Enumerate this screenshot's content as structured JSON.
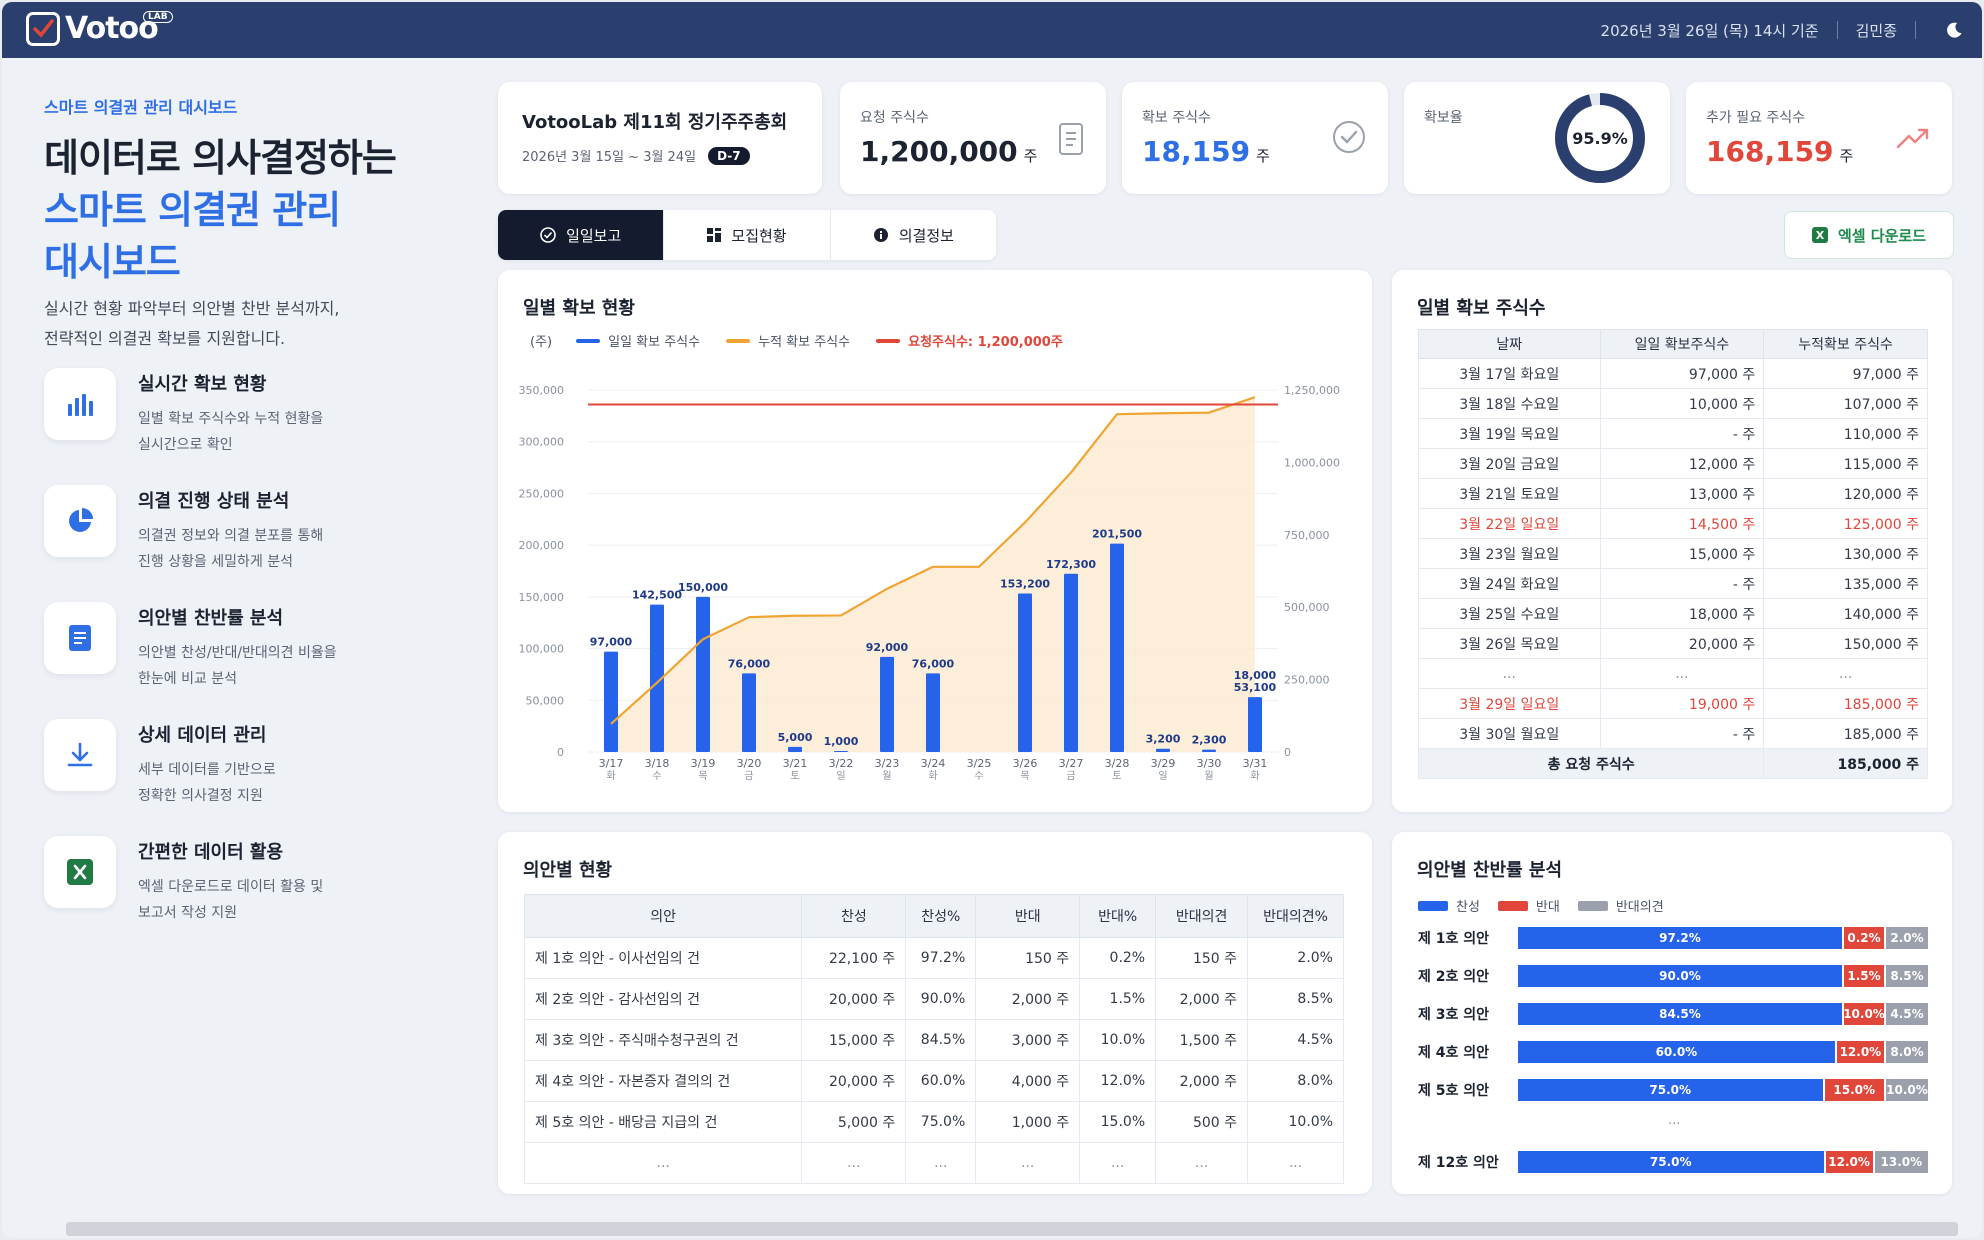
{
  "header": {
    "logo": "Votoo",
    "logo_badge": "LAB",
    "date_text": "2026년 3월 26일 (목) 14시 기준",
    "user": "김민종"
  },
  "hero": {
    "kicker": "스마트 의결권 관리 대시보드",
    "title_line1": "데이터로 의사결정하는",
    "title_line2": "스마트 의결권 관리",
    "title_line3": "대시보드",
    "desc_line1": "실시간 현황 파악부터 의안별 찬반 분석까지,",
    "desc_line2": "전략적인 의결권 확보를 지원합니다."
  },
  "features": [
    {
      "title": "실시간 확보 현황",
      "desc1": "일별 확보 주식수와 누적 현황을",
      "desc2": "실시간으로 확인",
      "icon": "bar-chart-icon"
    },
    {
      "title": "의결 진행 상태 분석",
      "desc1": "의결권 정보와 의결 분포를 통해",
      "desc2": "진행 상황을 세밀하게 분석",
      "icon": "pie-chart-icon"
    },
    {
      "title": "의안별 찬반률 분석",
      "desc1": "의안별 찬성/반대/반대의견 비율을",
      "desc2": "한눈에 비교 분석",
      "icon": "document-icon"
    },
    {
      "title": "상세 데이터 관리",
      "desc1": "세부 데이터를 기반으로",
      "desc2": "정확한 의사결정 지원",
      "icon": "download-icon"
    },
    {
      "title": "간편한 데이터 활용",
      "desc1": "엑셀 다운로드로 데이터 활용 및",
      "desc2": "보고서 작성 지원",
      "icon": "excel-icon"
    }
  ],
  "meeting": {
    "name": "VotooLab 제11회 정기주주총회",
    "period": "2026년 3월 15일 ~ 3월 24일",
    "dday": "D-7"
  },
  "stats": {
    "requested": {
      "label": "요청 주식수",
      "value": "1,200,000",
      "unit": "주"
    },
    "secured": {
      "label": "확보 주식수",
      "value": "18,159",
      "unit": "주"
    },
    "rate": {
      "label": "확보율",
      "value": "95.9%",
      "fraction": 0.959
    },
    "needed": {
      "label": "추가 필요 주식수",
      "value": "168,159",
      "unit": "주"
    }
  },
  "tabs": [
    {
      "label": "일일보고"
    },
    {
      "label": "모집현황"
    },
    {
      "label": "의결정보"
    }
  ],
  "excel_button": "엑셀 다운로드",
  "colors": {
    "bar": "#2563eb",
    "cumulative": "#f0a532",
    "target": "#e0463a",
    "area": "#fdebd3",
    "accent": "#2f6fe6",
    "red": "#e0463a",
    "gray": "#9aa1ac",
    "navy": "#2a3f6d"
  },
  "chart_data": {
    "type": "bar",
    "title": "일별 확보 현황",
    "unit_label": "(주)",
    "legend": [
      "일일 확보 주식수",
      "누적 확보 주식수",
      "요청주식수: 1,200,000주"
    ],
    "categories": [
      "3/17",
      "3/18",
      "3/19",
      "3/20",
      "3/21",
      "3/22",
      "3/23",
      "3/24",
      "3/25",
      "3/26",
      "3/27",
      "3/28",
      "3/29",
      "3/30",
      "3/31"
    ],
    "weekdays": [
      "화",
      "수",
      "목",
      "금",
      "토",
      "일",
      "월",
      "화",
      "수",
      "목",
      "금",
      "토",
      "일",
      "월",
      "화"
    ],
    "series": [
      {
        "name": "일일 확보 주식수",
        "axis": "left",
        "values": [
          97000,
          142500,
          150000,
          76000,
          5000,
          1000,
          92000,
          76000,
          0,
          153200,
          172300,
          201500,
          3200,
          2300,
          53100
        ],
        "labels": [
          "97,000",
          "142,500",
          "150,000",
          "76,000",
          "5,000",
          "1,000",
          "92,000",
          "76,000",
          "",
          "153,200",
          "172,300",
          "201,500",
          "3,200",
          "2,300",
          "18,000\n53,100"
        ]
      },
      {
        "name": "누적 확보 주식수",
        "axis": "right",
        "values": [
          97000,
          239500,
          389500,
          465500,
          470500,
          471500,
          563500,
          639500,
          639500,
          792700,
          965000,
          1166500,
          1169700,
          1172000,
          1225100
        ]
      },
      {
        "name": "요청주식수: 1,200,000주",
        "axis": "right",
        "values": [
          1200000,
          1200000,
          1200000,
          1200000,
          1200000,
          1200000,
          1200000,
          1200000,
          1200000,
          1200000,
          1200000,
          1200000,
          1200000,
          1200000,
          1200000
        ]
      }
    ],
    "ylim_left": [
      0,
      350000
    ],
    "ylim_right": [
      0,
      1250000
    ],
    "yticks_left": [
      "0",
      "50,000",
      "100,000",
      "150,000",
      "200,000",
      "250,000",
      "300,000",
      "350,000"
    ],
    "yticks_right": [
      "0",
      "250,000",
      "500,000",
      "750,000",
      "1,000,000",
      "1,250,000"
    ],
    "grid": true
  },
  "daily_table": {
    "title": "일별 확보 주식수",
    "headers": [
      "날짜",
      "일일 확보주식수",
      "누적확보 주식수"
    ],
    "rows": [
      {
        "date": "3월 17일 화요일",
        "daily": "97,000 주",
        "cum": "97,000 주",
        "red": false
      },
      {
        "date": "3월 18일 수요일",
        "daily": "10,000 주",
        "cum": "107,000 주",
        "red": false
      },
      {
        "date": "3월 19일 목요일",
        "daily": "- 주",
        "cum": "110,000 주",
        "red": false
      },
      {
        "date": "3월 20일 금요일",
        "daily": "12,000 주",
        "cum": "115,000 주",
        "red": false
      },
      {
        "date": "3월 21일 토요일",
        "daily": "13,000 주",
        "cum": "120,000 주",
        "red": false
      },
      {
        "date": "3월 22일 일요일",
        "daily": "14,500 주",
        "cum": "125,000 주",
        "red": true
      },
      {
        "date": "3월 23일 월요일",
        "daily": "15,000 주",
        "cum": "130,000 주",
        "red": false
      },
      {
        "date": "3월 24일 화요일",
        "daily": "- 주",
        "cum": "135,000 주",
        "red": false
      },
      {
        "date": "3월 25일 수요일",
        "daily": "18,000 주",
        "cum": "140,000 주",
        "red": false
      },
      {
        "date": "3월 26일 목요일",
        "daily": "20,000 주",
        "cum": "150,000 주",
        "red": false
      },
      {
        "date": "...",
        "daily": "...",
        "cum": "...",
        "red": false
      },
      {
        "date": "3월 29일 일요일",
        "daily": "19,000 주",
        "cum": "185,000 주",
        "red": true
      },
      {
        "date": "3월 30일 월요일",
        "daily": "- 주",
        "cum": "185,000 주",
        "red": false
      }
    ],
    "total_label": "총 요청 주식수",
    "total_value": "185,000 주"
  },
  "vote_table": {
    "title": "의안별 현황",
    "headers": [
      "의안",
      "찬성",
      "찬성%",
      "반대",
      "반대%",
      "반대의견",
      "반대의견%"
    ],
    "rows": [
      [
        "제 1호 의안 - 이사선임의 건",
        "22,100 주",
        "97.2%",
        "150 주",
        "0.2%",
        "150 주",
        "2.0%"
      ],
      [
        "제 2호 의안 - 감사선임의 건",
        "20,000 주",
        "90.0%",
        "2,000 주",
        "1.5%",
        "2,000 주",
        "8.5%"
      ],
      [
        "제 3호 의안 - 주식매수청구권의 건",
        "15,000 주",
        "84.5%",
        "3,000 주",
        "10.0%",
        "1,500 주",
        "4.5%"
      ],
      [
        "제 4호 의안 - 자본증자 결의의 건",
        "20,000 주",
        "60.0%",
        "4,000 주",
        "12.0%",
        "2,000 주",
        "8.0%"
      ],
      [
        "제 5호 의안 - 배당금 지급의 건",
        "5,000 주",
        "75.0%",
        "1,000 주",
        "15.0%",
        "500 주",
        "10.0%"
      ],
      [
        "...",
        "...",
        "...",
        "...",
        "...",
        "...",
        "..."
      ]
    ]
  },
  "ratio": {
    "title": "의안별 찬반률 분석",
    "legend": [
      "찬성",
      "반대",
      "반대의견"
    ],
    "ellipsis": "...",
    "items": [
      {
        "label": "제 1호 의안",
        "for": 97.2,
        "against": 0.2,
        "opinion": 2.0,
        "for_t": "97.2%",
        "against_t": "0.2%",
        "opinion_t": "2.0%"
      },
      {
        "label": "제 2호 의안",
        "for": 90.0,
        "against": 1.5,
        "opinion": 8.5,
        "for_t": "90.0%",
        "against_t": "1.5%",
        "opinion_t": "8.5%"
      },
      {
        "label": "제 3호 의안",
        "for": 84.5,
        "against": 10.0,
        "opinion": 4.5,
        "for_t": "84.5%",
        "against_t": "10.0%",
        "opinion_t": "4.5%"
      },
      {
        "label": "제 4호 의안",
        "for": 60.0,
        "against": 12.0,
        "opinion": 8.0,
        "for_t": "60.0%",
        "against_t": "12.0%",
        "opinion_t": "8.0%"
      },
      {
        "label": "제 5호 의안",
        "for": 75.0,
        "against": 15.0,
        "opinion": 10.0,
        "for_t": "75.0%",
        "against_t": "15.0%",
        "opinion_t": "10.0%"
      },
      {
        "label": "제 12호 의안",
        "for": 75.0,
        "against": 12.0,
        "opinion": 13.0,
        "for_t": "75.0%",
        "against_t": "12.0%",
        "opinion_t": "13.0%"
      }
    ]
  }
}
